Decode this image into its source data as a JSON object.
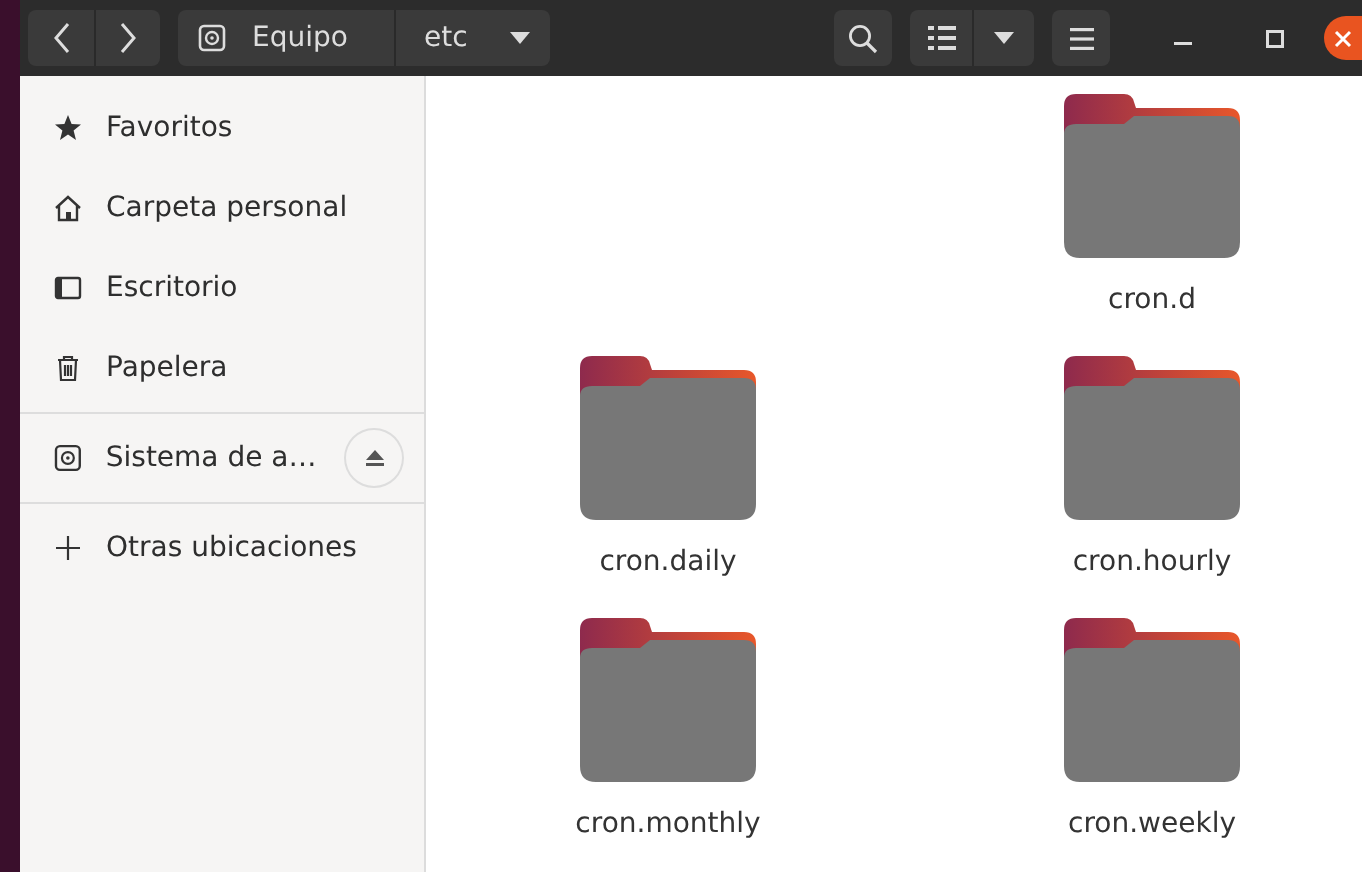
{
  "header": {
    "path": [
      {
        "label": "Equipo"
      },
      {
        "label": "etc"
      }
    ]
  },
  "sidebar": {
    "items": [
      {
        "label": "Favoritos",
        "kind": "place"
      },
      {
        "label": "Carpeta personal",
        "kind": "place"
      },
      {
        "label": "Escritorio",
        "kind": "place"
      },
      {
        "label": "Papelera",
        "kind": "place"
      },
      {
        "label": "Sistema de a…",
        "kind": "device"
      },
      {
        "label": "Otras ubicaciones",
        "kind": "other"
      }
    ]
  },
  "files": [
    {
      "name": "cron.d"
    },
    {
      "name": "cron.daily"
    },
    {
      "name": "cron.hourly"
    },
    {
      "name": "cron.monthly"
    },
    {
      "name": "cron.weekly"
    }
  ]
}
